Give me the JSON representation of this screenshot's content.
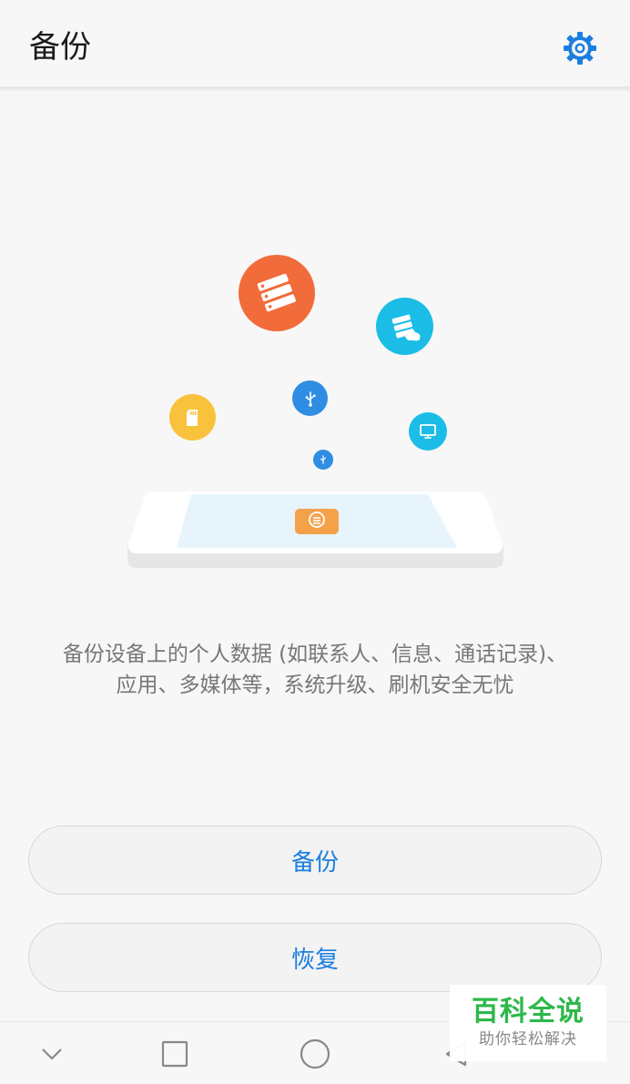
{
  "header": {
    "title": "备份",
    "settings_icon": "gear-icon"
  },
  "colors": {
    "accent": "#1c7fe0",
    "orange": "#f26b3a",
    "cyan": "#1bbde6",
    "yellow": "#f9c23c",
    "blue": "#2f8de4"
  },
  "description": {
    "line1": "备份设备上的个人数据 (如联系人、信息、通话记录)、",
    "line2": "应用、多媒体等，系统升级、刷机安全无忧"
  },
  "buttons": {
    "backup": "备份",
    "restore": "恢复"
  },
  "navbar": {
    "icons": [
      "chevron-down-icon",
      "square-icon",
      "circle-icon",
      "back-triangle-icon"
    ]
  },
  "watermark": {
    "main": "百科全说",
    "sub": "助你轻松解决"
  }
}
